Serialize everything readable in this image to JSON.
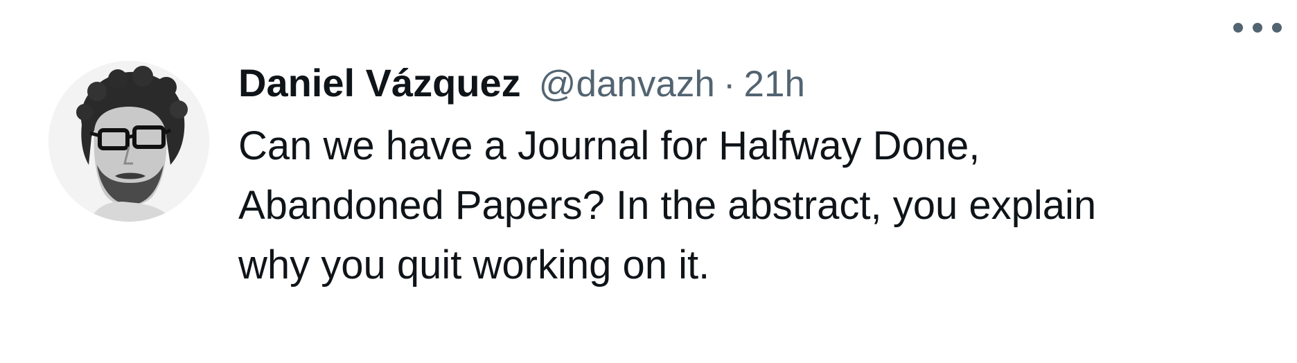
{
  "tweet": {
    "author_name": "Daniel Vázquez",
    "handle": "@danvazh",
    "separator": "·",
    "time": "21h",
    "lines": [
      "Can we have a Journal for Halfway Done,",
      "Abandoned Papers? In the abstract, you explain",
      "why you quit working on it."
    ],
    "more_icon": "more-horizontal-icon",
    "avatar_icon": "avatar-photo"
  },
  "colors": {
    "text_primary": "#0f1419",
    "text_secondary": "#536471",
    "background": "#ffffff"
  }
}
